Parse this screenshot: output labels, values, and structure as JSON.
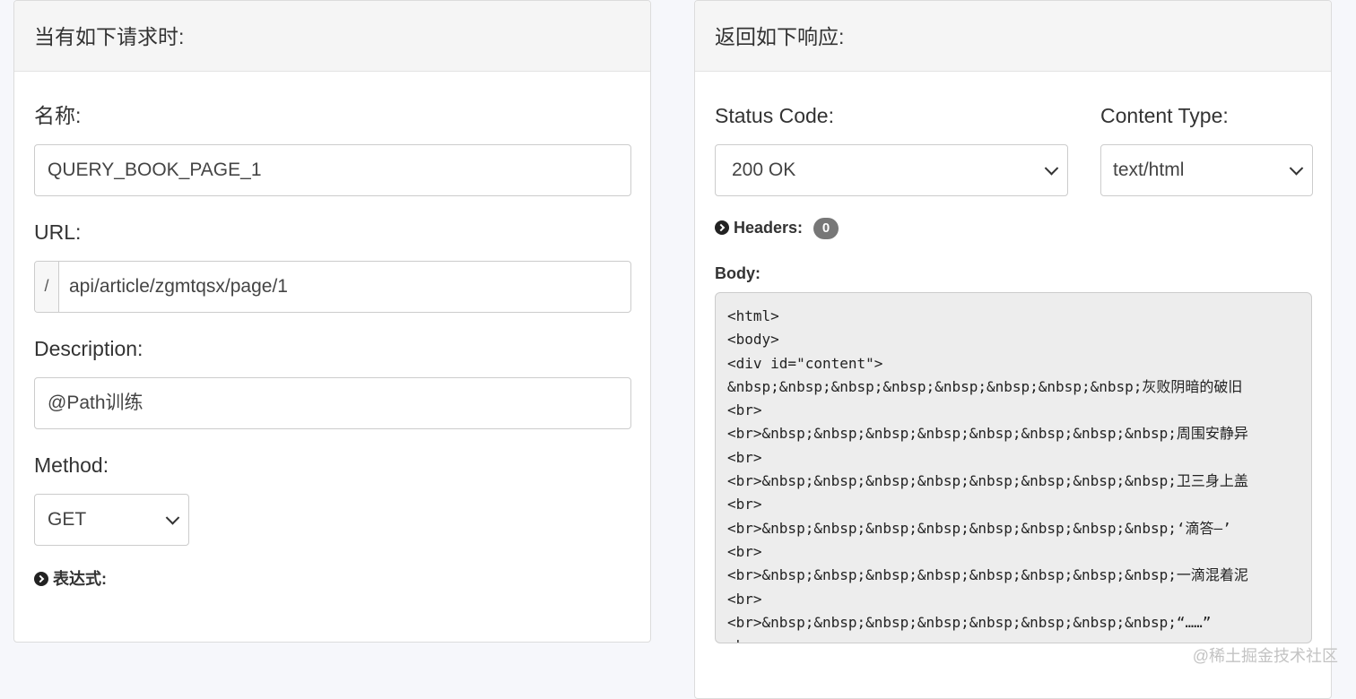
{
  "request": {
    "header": "当有如下请求时:",
    "name_label": "名称:",
    "name_value": "QUERY_BOOK_PAGE_1",
    "url_label": "URL:",
    "url_prefix": "/",
    "url_value": "api/article/zgmtqsx/page/1",
    "description_label": "Description:",
    "description_value": "@Path训练",
    "method_label": "Method:",
    "method_value": "GET",
    "expression_label": "表达式:"
  },
  "response": {
    "header": "返回如下响应:",
    "status_label": "Status Code:",
    "status_value": "200 OK",
    "content_type_label": "Content Type:",
    "content_type_value": "text/html",
    "headers_label": "Headers:",
    "headers_count": "0",
    "body_label": "Body:",
    "body_lines": [
      "<html>",
      "<body>",
      "<div id=\"content\">",
      "&nbsp;&nbsp;&nbsp;&nbsp;&nbsp;&nbsp;&nbsp;&nbsp;灰败阴暗的破旧",
      "<br>",
      "<br>&nbsp;&nbsp;&nbsp;&nbsp;&nbsp;&nbsp;&nbsp;&nbsp;周围安静异",
      "<br>",
      "<br>&nbsp;&nbsp;&nbsp;&nbsp;&nbsp;&nbsp;&nbsp;&nbsp;卫三身上盖",
      "<br>",
      "<br>&nbsp;&nbsp;&nbsp;&nbsp;&nbsp;&nbsp;&nbsp;&nbsp;‘滴答—’",
      "<br>",
      "<br>&nbsp;&nbsp;&nbsp;&nbsp;&nbsp;&nbsp;&nbsp;&nbsp;一滴混着泥",
      "<br>",
      "<br>&nbsp;&nbsp;&nbsp;&nbsp;&nbsp;&nbsp;&nbsp;&nbsp;“……”",
      "<br>"
    ]
  },
  "watermark": "@稀土掘金技术社区"
}
